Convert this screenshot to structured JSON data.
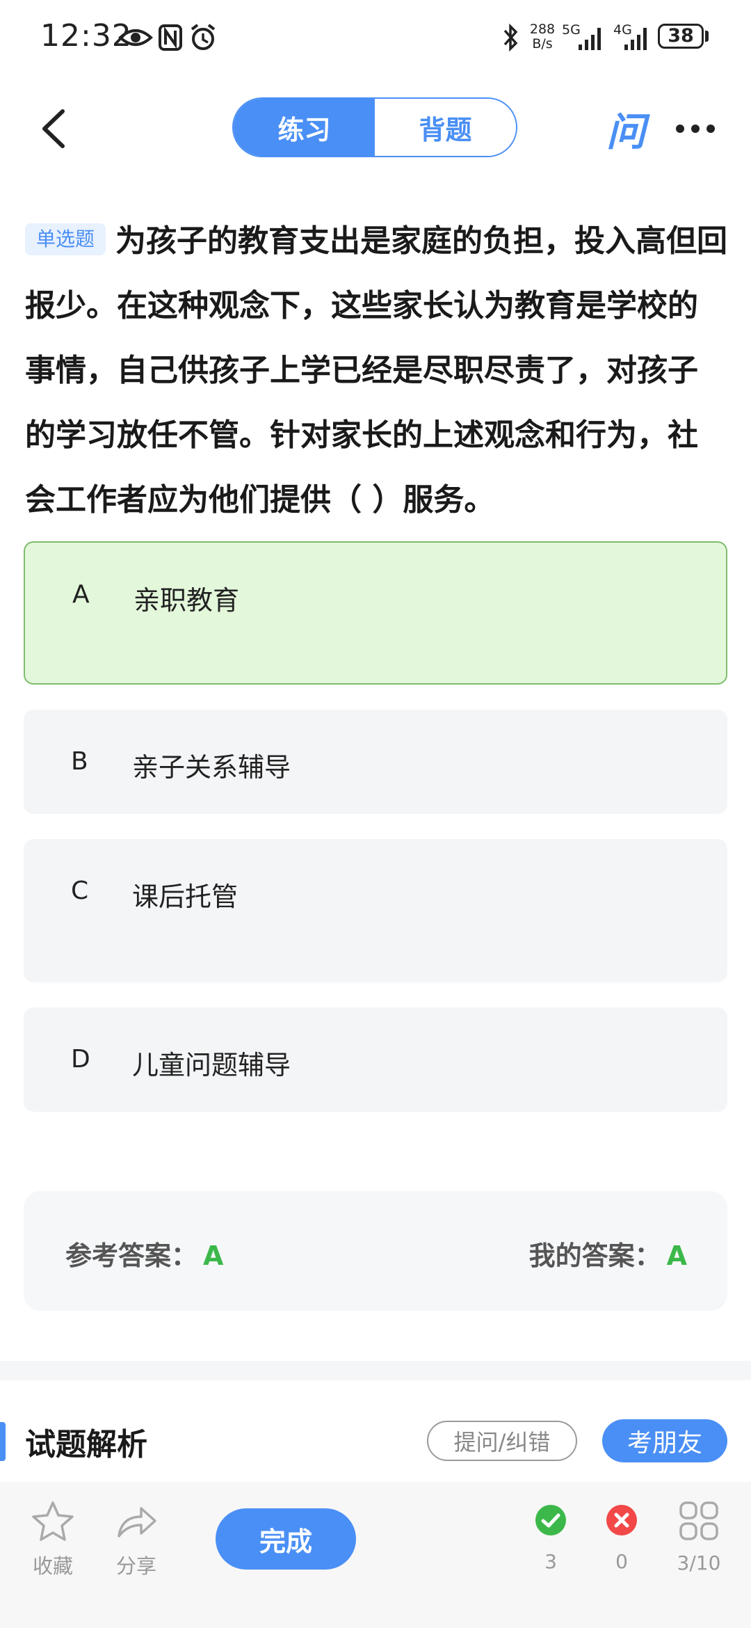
{
  "status_bar": {
    "time": "12:32",
    "net_speed_value": "288",
    "net_speed_unit": "B/s",
    "network_5g": "5G",
    "network_4g": "4G",
    "battery": "38"
  },
  "header": {
    "tabs": [
      {
        "label": "练习",
        "active": true
      },
      {
        "label": "背题",
        "active": false
      }
    ],
    "ask_icon_glyph": "问"
  },
  "question": {
    "type_tag": "单选题",
    "text": "为孩子的教育支出是家庭的负担，投入高但回报少。在这种观念下，这些家长认为教育是学校的事情，自己供孩子上学已经是尽职尽责了，对孩子的学习放任不管。针对家长的上述观念和行为，社会工作者应为他们提供（ ）服务。"
  },
  "options": [
    {
      "letter": "A",
      "text": "亲职教育",
      "state": "correct"
    },
    {
      "letter": "B",
      "text": "亲子关系辅导",
      "state": "normal"
    },
    {
      "letter": "C",
      "text": "课后托管",
      "state": "normal"
    },
    {
      "letter": "D",
      "text": "儿童问题辅导",
      "state": "normal"
    }
  ],
  "answer": {
    "reference_label": "参考答案：",
    "reference_value": "A",
    "mine_label": "我的答案：",
    "mine_value": "A"
  },
  "analysis": {
    "title": "试题解析",
    "ask_button": "提问/纠错",
    "exam_button": "考朋友"
  },
  "bottom_bar": {
    "favorite": "收藏",
    "share": "分享",
    "done": "完成",
    "correct_count": "3",
    "wrong_count": "0",
    "progress": "3/10"
  },
  "colors": {
    "accent": "#4a8ff5",
    "correct_bg": "#e3f7da",
    "correct_text": "#3cb84a",
    "wrong": "#f24848"
  }
}
